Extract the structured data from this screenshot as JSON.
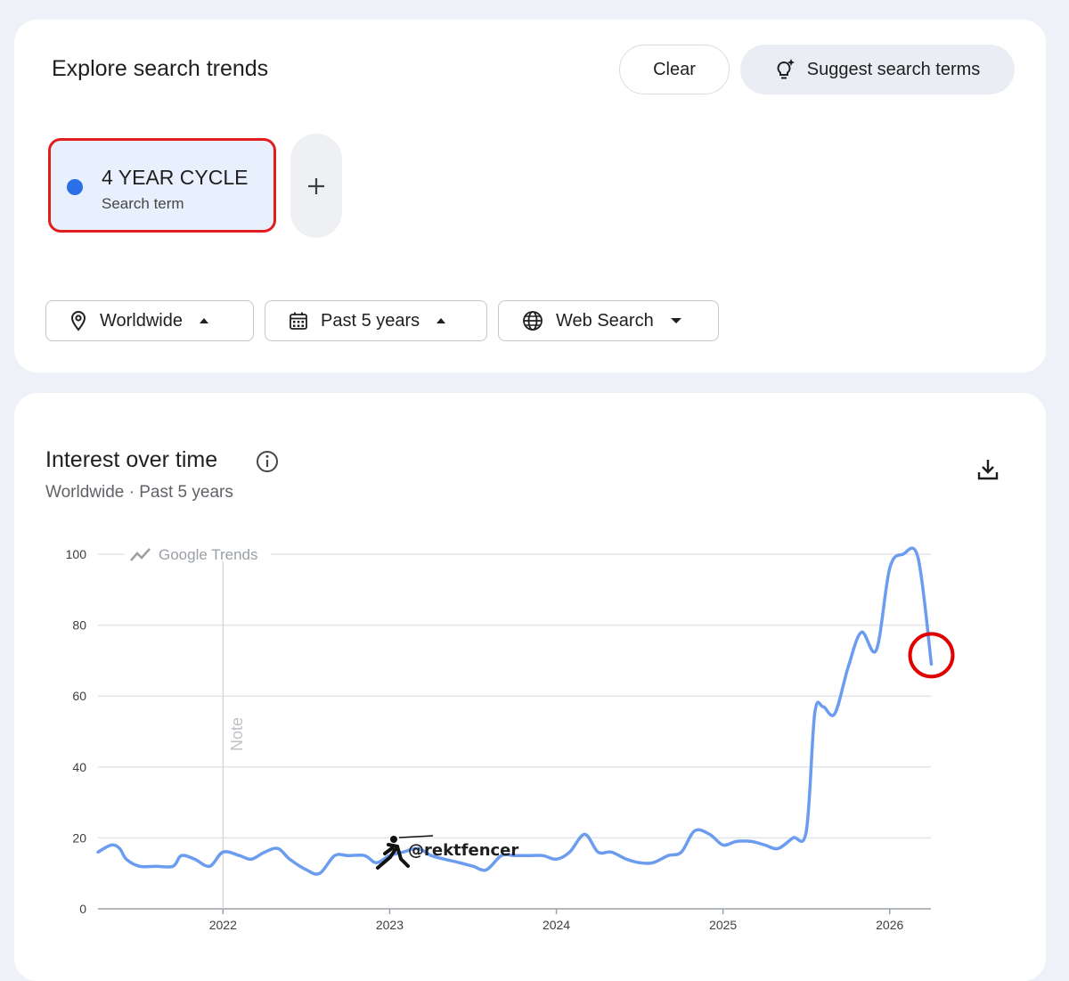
{
  "explore": {
    "title": "Explore search trends",
    "clear_label": "Clear",
    "suggest_label": "Suggest search terms",
    "suggest_icon": "lightbulb-sparkle-icon",
    "term": {
      "name": "4 YEAR CYCLE",
      "type": "Search term",
      "color": "#2b6fe6"
    },
    "add_icon": "plus-icon",
    "filters": [
      {
        "label": "Worldwide",
        "icon": "location-pin-icon",
        "caret": "caret-up-icon"
      },
      {
        "label": "Past 5 years",
        "icon": "calendar-icon",
        "caret": "caret-up-icon"
      },
      {
        "label": "Web Search",
        "icon": "globe-icon",
        "caret": "caret-down-icon"
      }
    ]
  },
  "interest": {
    "title": "Interest over time",
    "subtitle": "Worldwide · Past 5 years",
    "info_icon": "info-icon",
    "download_icon": "download-icon",
    "watermark": "Google Trends",
    "note_label": "Note",
    "credit": "@rektfencer"
  },
  "chart_data": {
    "type": "line",
    "title": "",
    "xlabel": "",
    "ylabel": "",
    "ylim": [
      0,
      100
    ],
    "xlim": [
      2021.25,
      2026.25
    ],
    "yticks": [
      0,
      20,
      40,
      60,
      80,
      100
    ],
    "xticks": [
      "2022",
      "2023",
      "2024",
      "2025",
      "2026"
    ],
    "grid": true,
    "line_color": "#6b9cef",
    "highlight_color": "#e00000",
    "note_at": 2022,
    "series": [
      {
        "x": [
          2021.25,
          2021.33,
          2021.38,
          2021.42,
          2021.5,
          2021.6,
          2021.7,
          2021.75,
          2021.83,
          2021.92,
          2022.0,
          2022.1,
          2022.17,
          2022.25,
          2022.33,
          2022.4,
          2022.5,
          2022.58,
          2022.67,
          2022.75,
          2022.85,
          2022.92,
          2023.0,
          2023.08,
          2023.17,
          2023.25,
          2023.33,
          2023.42,
          2023.5,
          2023.58,
          2023.67,
          2023.75,
          2023.83,
          2023.92,
          2024.0,
          2024.08,
          2024.17,
          2024.25,
          2024.33,
          2024.42,
          2024.5,
          2024.58,
          2024.67,
          2024.75,
          2024.83,
          2024.92,
          2025.0,
          2025.08,
          2025.17,
          2025.25,
          2025.33,
          2025.42,
          2025.5,
          2025.55,
          2025.6,
          2025.67,
          2025.75,
          2025.83,
          2025.92,
          2026.0,
          2026.08,
          2026.17,
          2026.25
        ],
        "values": [
          16,
          18,
          17,
          14,
          12,
          12,
          12,
          15,
          14,
          12,
          16,
          15,
          14,
          16,
          17,
          14,
          11,
          10,
          15,
          15,
          15,
          13,
          15,
          16,
          17,
          15,
          14,
          13,
          12,
          11,
          15,
          15,
          15,
          15,
          14,
          16,
          21,
          16,
          16,
          14,
          13,
          13,
          15,
          16,
          22,
          21,
          18,
          19,
          19,
          18,
          17,
          20,
          22,
          55,
          57,
          55,
          68,
          78,
          73,
          96,
          100,
          99,
          69
        ]
      }
    ]
  }
}
